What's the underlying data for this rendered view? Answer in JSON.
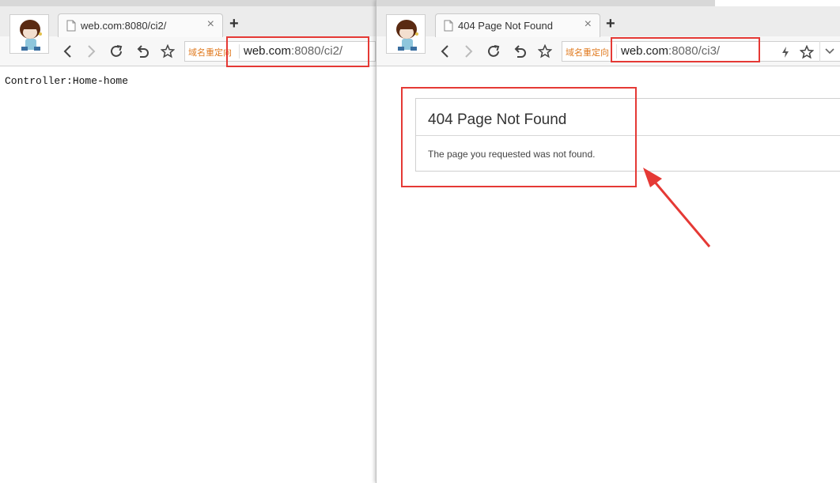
{
  "left_window": {
    "tab": {
      "title": "web.com:8080/ci2/",
      "close": "×"
    },
    "new_tab": "+",
    "redirect_tag": "域名重定向",
    "url": {
      "host": "web.com",
      "rest": ":8080/ci2/"
    },
    "page_text": "Controller:Home-home"
  },
  "right_window": {
    "tab": {
      "title": "404 Page Not Found",
      "close": "×"
    },
    "new_tab": "+",
    "redirect_tag": "域名重定向",
    "url": {
      "host": "web.com",
      "rest": ":8080/ci3/"
    },
    "error": {
      "title": "404 Page Not Found",
      "message": "The page you requested was not found."
    }
  },
  "colors": {
    "annotation_red": "#e53935",
    "redirect_tag": "#e07a1f"
  },
  "icons": [
    "page-icon",
    "back-icon",
    "forward-icon",
    "reload-icon",
    "undo-icon",
    "star-icon",
    "lightning-icon",
    "chevron-down-icon",
    "avatar-icon"
  ]
}
